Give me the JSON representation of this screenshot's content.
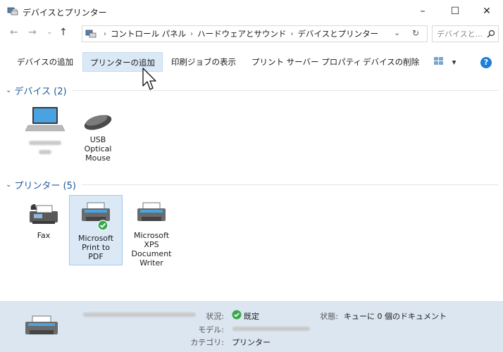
{
  "window": {
    "title": "デバイスとプリンター",
    "min_glyph": "–",
    "max_glyph": "☐",
    "close_glyph": "✕"
  },
  "nav": {
    "back_glyph": "←",
    "forward_glyph": "→",
    "recent_glyph": "⌄",
    "up_glyph": "↑"
  },
  "address": {
    "crumbs": [
      "コントロール パネル",
      "ハードウェアとサウンド",
      "デバイスとプリンター"
    ],
    "sep_glyph": "›",
    "dropdown_glyph": "⌄",
    "refresh_glyph": "↻",
    "search_placeholder": "デバイスと..."
  },
  "toolbar": {
    "add_device": "デバイスの追加",
    "add_printer": "プリンターの追加",
    "see_print_jobs": "印刷ジョブの表示",
    "print_server_props": "プリント サーバー プロパティ",
    "remove_device": "デバイスの削除",
    "view_dropdown_glyph": "▾",
    "help_glyph": "?"
  },
  "groups": {
    "devices": {
      "label": "デバイス (2)",
      "chev": "⌄"
    },
    "printers": {
      "label": "プリンター (5)",
      "chev": "⌄"
    }
  },
  "devices": [
    {
      "caption": ""
    },
    {
      "caption_lines": [
        "USB",
        "Optical",
        "Mouse"
      ]
    }
  ],
  "printers": [
    {
      "caption_lines": [
        "Fax"
      ]
    },
    {
      "caption_lines": [
        "Microsoft",
        "Print to",
        "PDF"
      ],
      "default": true
    },
    {
      "caption_lines": [
        "Microsoft",
        "XPS",
        "Document",
        "Writer"
      ]
    }
  ],
  "details": {
    "status_label": "状況:",
    "status_value": "既定",
    "model_label": "モデル:",
    "category_label": "カテゴリ:",
    "category_value": "プリンター",
    "state_label": "状態:",
    "state_value": "キューに 0 個のドキュメント"
  },
  "colors": {
    "accent": "#1c5a9c",
    "selection_bg": "#dbe9f7",
    "details_bg": "#dbe6f1",
    "ok_green": "#3aa84a",
    "help_blue": "#1e7fd6"
  }
}
